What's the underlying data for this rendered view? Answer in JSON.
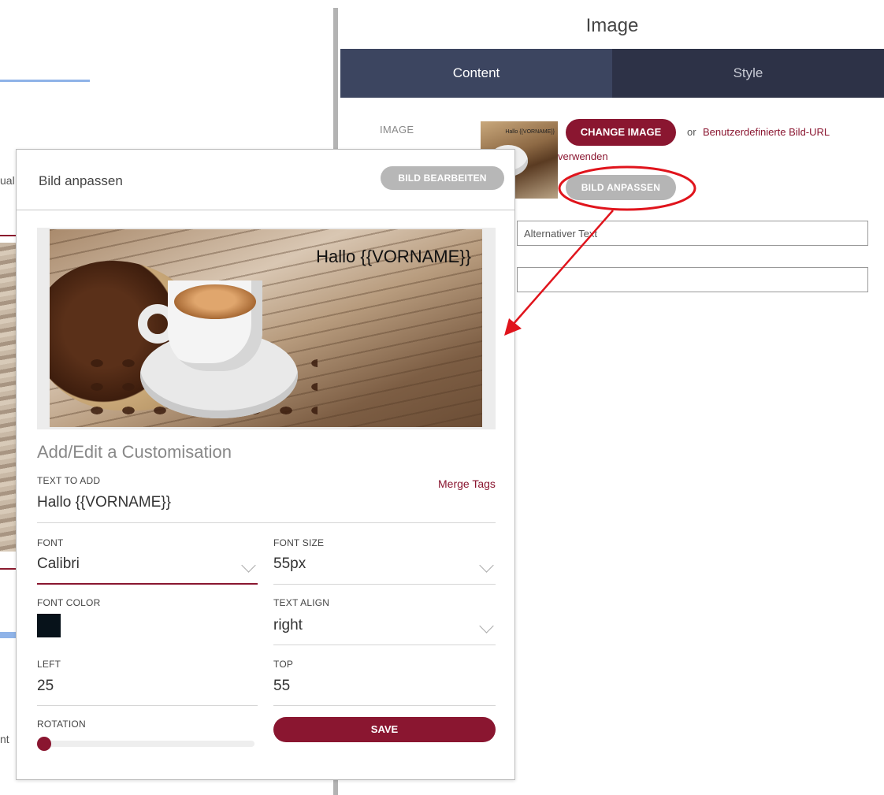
{
  "background": {
    "fragment_1": "ual",
    "fragment_2": "nt"
  },
  "panel": {
    "title": "Image",
    "tabs": [
      {
        "label": "Content",
        "active": true
      },
      {
        "label": "Style",
        "active": false
      }
    ],
    "image_label": "IMAGE",
    "thumbnail_text": "Hallo {{VORNAME}}",
    "change_image_label": "CHANGE IMAGE",
    "or_text": "or",
    "custom_url_text_1": "Benutzerdefinierte Bild-URL",
    "custom_url_text_2": "verwenden",
    "customize_button_label": "BILD ANPASSEN",
    "alt_text_value": "Alternativer Text",
    "link_value": ""
  },
  "modal": {
    "title": "Bild anpassen",
    "edit_button_label": "BILD BEARBEITEN",
    "preview_overlay_text": "Hallo {{VORNAME}}",
    "section_title": "Add/Edit a Customisation",
    "text_to_add": {
      "label": "TEXT TO ADD",
      "value": "Hallo {{VORNAME}}"
    },
    "merge_tags_label": "Merge Tags",
    "font": {
      "label": "FONT",
      "value": "Calibri"
    },
    "font_size": {
      "label": "FONT SIZE",
      "value": "55px"
    },
    "font_color": {
      "label": "FONT COLOR",
      "value": "#07121a"
    },
    "text_align": {
      "label": "TEXT ALIGN",
      "value": "right"
    },
    "left": {
      "label": "LEFT",
      "value": "25"
    },
    "top": {
      "label": "TOP",
      "value": "55"
    },
    "rotation": {
      "label": "ROTATION",
      "value": 0
    },
    "save_label": "SAVE"
  },
  "colors": {
    "accent": "#8a1630",
    "tab_active": "#3c4560",
    "tab_inactive": "#2d3247",
    "annotation_red": "#e0141c"
  }
}
